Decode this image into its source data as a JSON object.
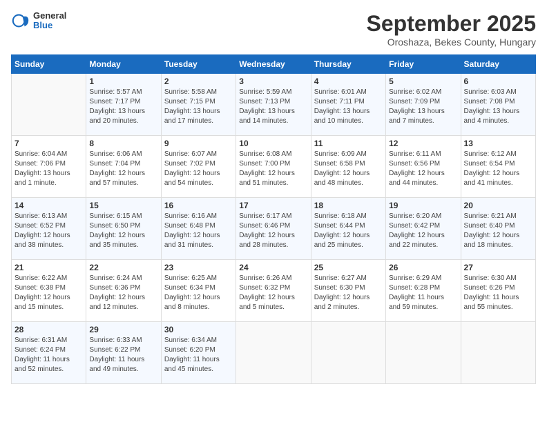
{
  "header": {
    "logo_general": "General",
    "logo_blue": "Blue",
    "month_title": "September 2025",
    "subtitle": "Oroshaza, Bekes County, Hungary"
  },
  "days_of_week": [
    "Sunday",
    "Monday",
    "Tuesday",
    "Wednesday",
    "Thursday",
    "Friday",
    "Saturday"
  ],
  "weeks": [
    [
      {
        "day": "",
        "content": ""
      },
      {
        "day": "1",
        "content": "Sunrise: 5:57 AM\nSunset: 7:17 PM\nDaylight: 13 hours\nand 20 minutes."
      },
      {
        "day": "2",
        "content": "Sunrise: 5:58 AM\nSunset: 7:15 PM\nDaylight: 13 hours\nand 17 minutes."
      },
      {
        "day": "3",
        "content": "Sunrise: 5:59 AM\nSunset: 7:13 PM\nDaylight: 13 hours\nand 14 minutes."
      },
      {
        "day": "4",
        "content": "Sunrise: 6:01 AM\nSunset: 7:11 PM\nDaylight: 13 hours\nand 10 minutes."
      },
      {
        "day": "5",
        "content": "Sunrise: 6:02 AM\nSunset: 7:09 PM\nDaylight: 13 hours\nand 7 minutes."
      },
      {
        "day": "6",
        "content": "Sunrise: 6:03 AM\nSunset: 7:08 PM\nDaylight: 13 hours\nand 4 minutes."
      }
    ],
    [
      {
        "day": "7",
        "content": "Sunrise: 6:04 AM\nSunset: 7:06 PM\nDaylight: 13 hours\nand 1 minute."
      },
      {
        "day": "8",
        "content": "Sunrise: 6:06 AM\nSunset: 7:04 PM\nDaylight: 12 hours\nand 57 minutes."
      },
      {
        "day": "9",
        "content": "Sunrise: 6:07 AM\nSunset: 7:02 PM\nDaylight: 12 hours\nand 54 minutes."
      },
      {
        "day": "10",
        "content": "Sunrise: 6:08 AM\nSunset: 7:00 PM\nDaylight: 12 hours\nand 51 minutes."
      },
      {
        "day": "11",
        "content": "Sunrise: 6:09 AM\nSunset: 6:58 PM\nDaylight: 12 hours\nand 48 minutes."
      },
      {
        "day": "12",
        "content": "Sunrise: 6:11 AM\nSunset: 6:56 PM\nDaylight: 12 hours\nand 44 minutes."
      },
      {
        "day": "13",
        "content": "Sunrise: 6:12 AM\nSunset: 6:54 PM\nDaylight: 12 hours\nand 41 minutes."
      }
    ],
    [
      {
        "day": "14",
        "content": "Sunrise: 6:13 AM\nSunset: 6:52 PM\nDaylight: 12 hours\nand 38 minutes."
      },
      {
        "day": "15",
        "content": "Sunrise: 6:15 AM\nSunset: 6:50 PM\nDaylight: 12 hours\nand 35 minutes."
      },
      {
        "day": "16",
        "content": "Sunrise: 6:16 AM\nSunset: 6:48 PM\nDaylight: 12 hours\nand 31 minutes."
      },
      {
        "day": "17",
        "content": "Sunrise: 6:17 AM\nSunset: 6:46 PM\nDaylight: 12 hours\nand 28 minutes."
      },
      {
        "day": "18",
        "content": "Sunrise: 6:18 AM\nSunset: 6:44 PM\nDaylight: 12 hours\nand 25 minutes."
      },
      {
        "day": "19",
        "content": "Sunrise: 6:20 AM\nSunset: 6:42 PM\nDaylight: 12 hours\nand 22 minutes."
      },
      {
        "day": "20",
        "content": "Sunrise: 6:21 AM\nSunset: 6:40 PM\nDaylight: 12 hours\nand 18 minutes."
      }
    ],
    [
      {
        "day": "21",
        "content": "Sunrise: 6:22 AM\nSunset: 6:38 PM\nDaylight: 12 hours\nand 15 minutes."
      },
      {
        "day": "22",
        "content": "Sunrise: 6:24 AM\nSunset: 6:36 PM\nDaylight: 12 hours\nand 12 minutes."
      },
      {
        "day": "23",
        "content": "Sunrise: 6:25 AM\nSunset: 6:34 PM\nDaylight: 12 hours\nand 8 minutes."
      },
      {
        "day": "24",
        "content": "Sunrise: 6:26 AM\nSunset: 6:32 PM\nDaylight: 12 hours\nand 5 minutes."
      },
      {
        "day": "25",
        "content": "Sunrise: 6:27 AM\nSunset: 6:30 PM\nDaylight: 12 hours\nand 2 minutes."
      },
      {
        "day": "26",
        "content": "Sunrise: 6:29 AM\nSunset: 6:28 PM\nDaylight: 11 hours\nand 59 minutes."
      },
      {
        "day": "27",
        "content": "Sunrise: 6:30 AM\nSunset: 6:26 PM\nDaylight: 11 hours\nand 55 minutes."
      }
    ],
    [
      {
        "day": "28",
        "content": "Sunrise: 6:31 AM\nSunset: 6:24 PM\nDaylight: 11 hours\nand 52 minutes."
      },
      {
        "day": "29",
        "content": "Sunrise: 6:33 AM\nSunset: 6:22 PM\nDaylight: 11 hours\nand 49 minutes."
      },
      {
        "day": "30",
        "content": "Sunrise: 6:34 AM\nSunset: 6:20 PM\nDaylight: 11 hours\nand 45 minutes."
      },
      {
        "day": "",
        "content": ""
      },
      {
        "day": "",
        "content": ""
      },
      {
        "day": "",
        "content": ""
      },
      {
        "day": "",
        "content": ""
      }
    ]
  ]
}
